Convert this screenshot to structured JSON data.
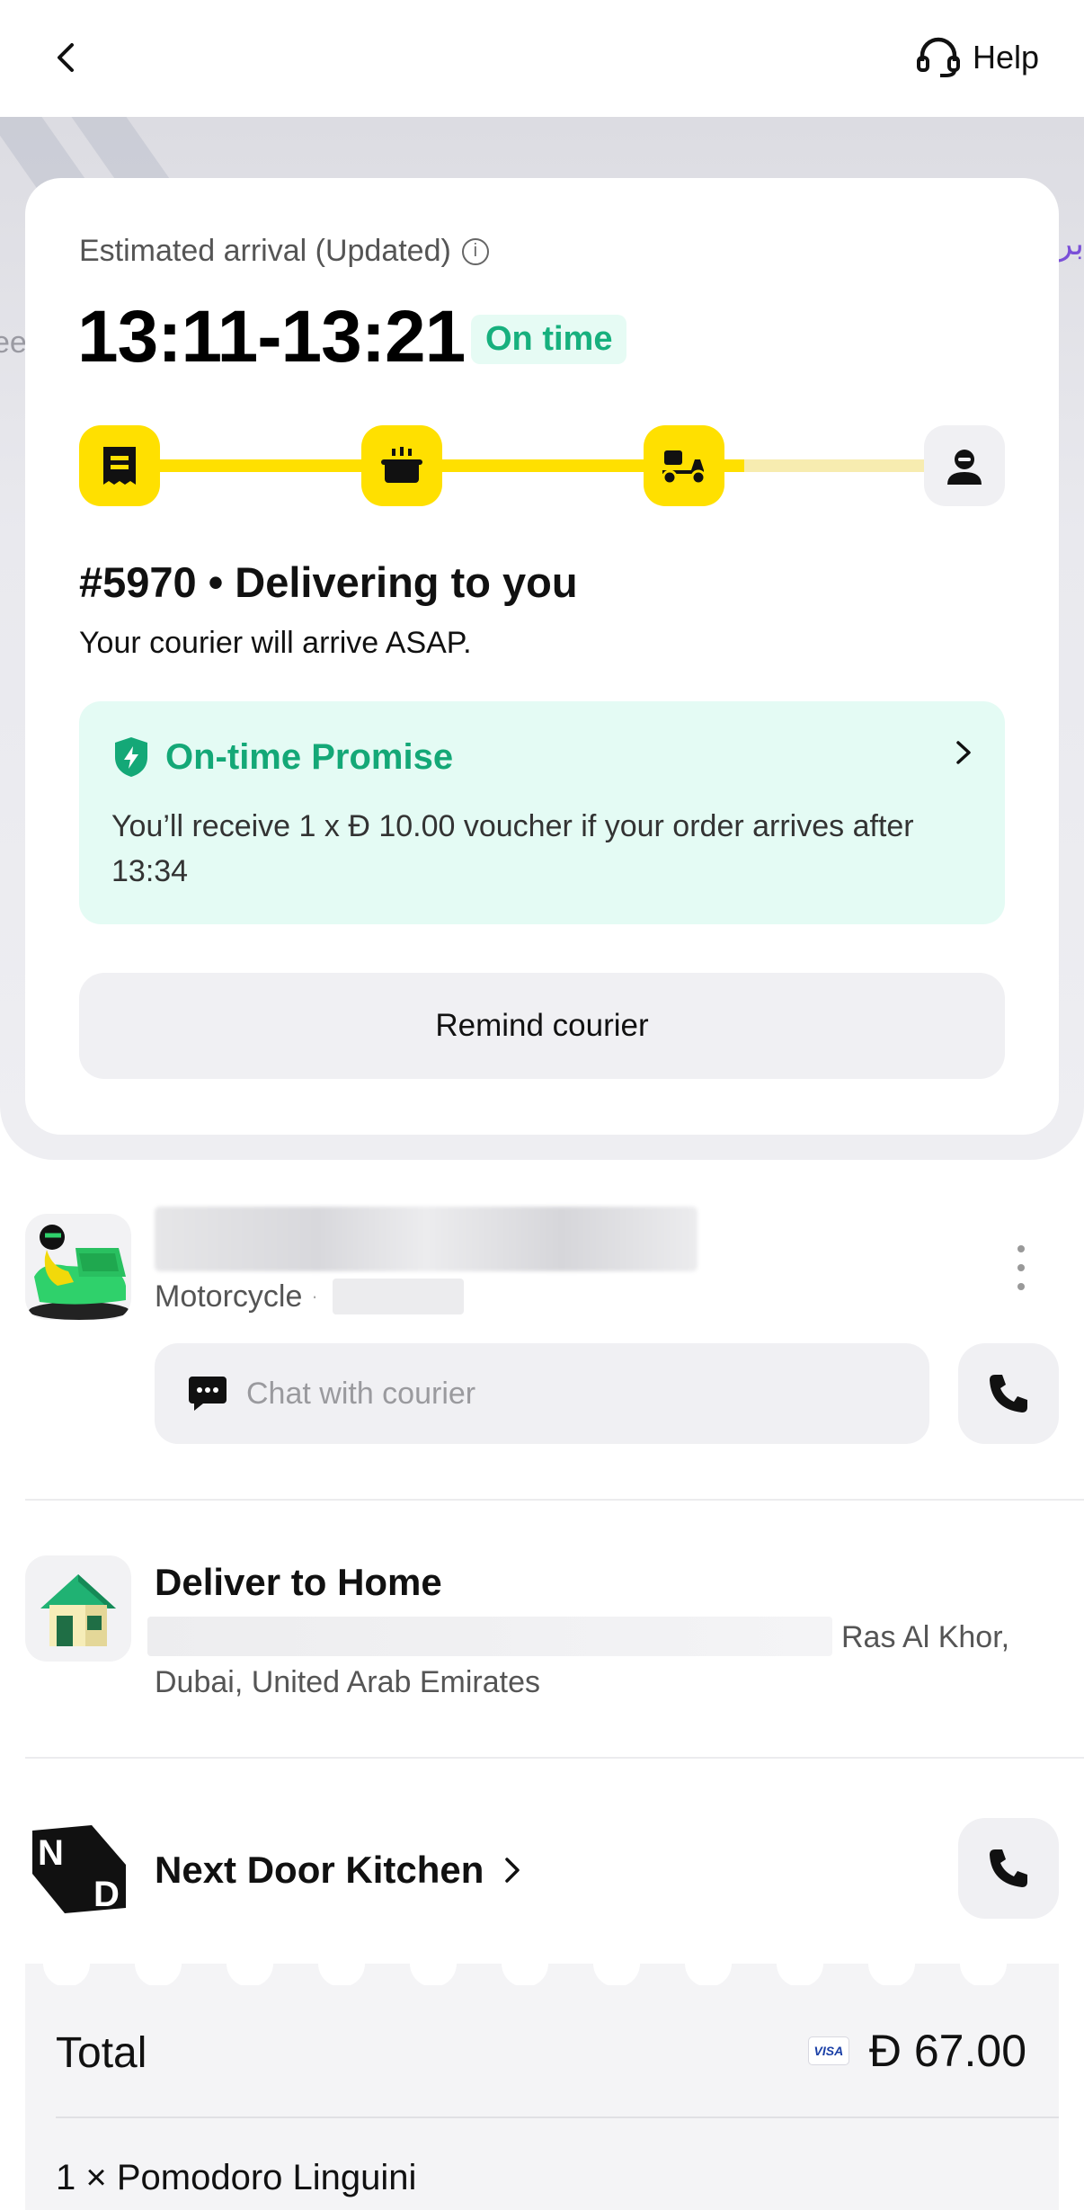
{
  "header": {
    "help_label": "Help"
  },
  "map": {
    "label_right": "بر",
    "label_left": "ee"
  },
  "eta": {
    "label": "Estimated arrival (Updated)",
    "time": "13:11-13:21",
    "status": "On time"
  },
  "progress": {
    "steps": [
      "receipt-icon",
      "cooking-pot-icon",
      "scooter-icon",
      "customer-icon"
    ],
    "completed_steps": 3
  },
  "order": {
    "title": "#5970 • Delivering to you",
    "subtitle": "Your courier will arrive ASAP."
  },
  "promise": {
    "title": "On-time Promise",
    "body": "You’ll receive 1 x Ð 10.00 voucher if your order arrives after 13:34"
  },
  "remind_label": "Remind courier",
  "courier": {
    "vehicle": "Motorcycle",
    "separator": "·",
    "chat_placeholder": "Chat with courier"
  },
  "deliver": {
    "title": "Deliver to Home",
    "address_line1": "Ras Al Khor,",
    "address_line2": "Dubai, United Arab Emirates"
  },
  "restaurant": {
    "name": "Next Door Kitchen"
  },
  "receipt": {
    "total_label": "Total",
    "card_brand": "VISA",
    "total_value": "Ð 67.00",
    "item_line": "1 × Pomodoro Linguini"
  },
  "colors": {
    "brand_yellow": "#ffe000",
    "success_green": "#17b07e",
    "promise_bg": "#e4fbf4",
    "gray_surface": "#f0f0f3"
  }
}
